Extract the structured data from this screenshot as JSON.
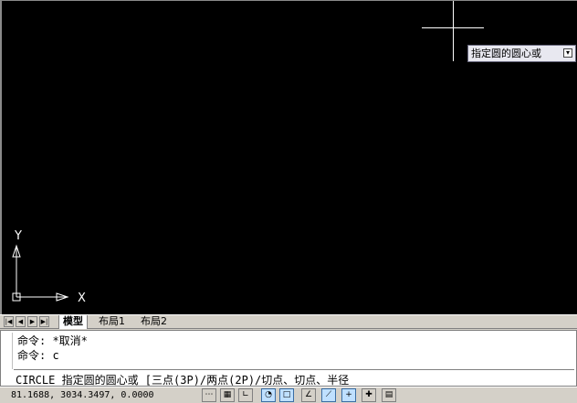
{
  "tooltip": {
    "text": "指定圆的圆心或",
    "icon": "dropdown-icon"
  },
  "ucs": {
    "y_label": "Y",
    "x_label": "X"
  },
  "tabs": [
    {
      "label": "模型",
      "active": true
    },
    {
      "label": "布局1",
      "active": false
    },
    {
      "label": "布局2",
      "active": false
    }
  ],
  "command": {
    "history": [
      "命令: *取消*",
      "命令: c"
    ],
    "current": "CIRCLE 指定圆的圆心或 [三点(3P)/两点(2P)/切点、切点、半径"
  },
  "status": {
    "coordinates": "81.1688,    3034.3497, 0.0000"
  }
}
